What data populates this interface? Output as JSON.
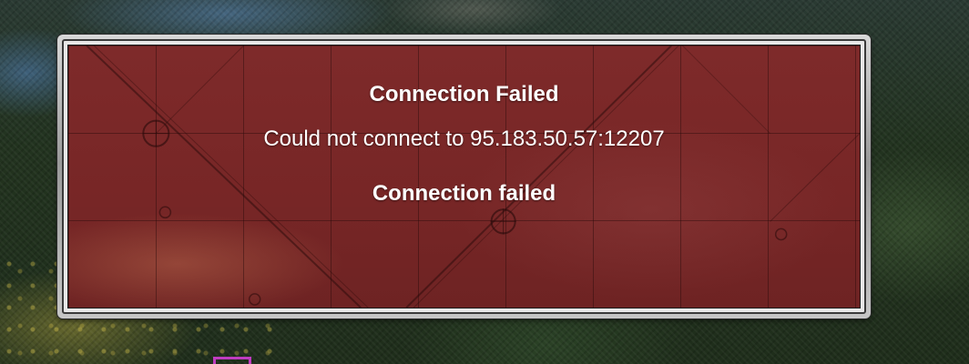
{
  "dialog": {
    "title": "Connection Failed",
    "detail": "Could not connect to 95.183.50.57:12207",
    "reason": "Connection failed"
  },
  "colors": {
    "panel_red": "#7a2828",
    "frame_gray": "#bdbdbd",
    "text": "#ffffff",
    "marker_magenta": "#c03cc0"
  }
}
